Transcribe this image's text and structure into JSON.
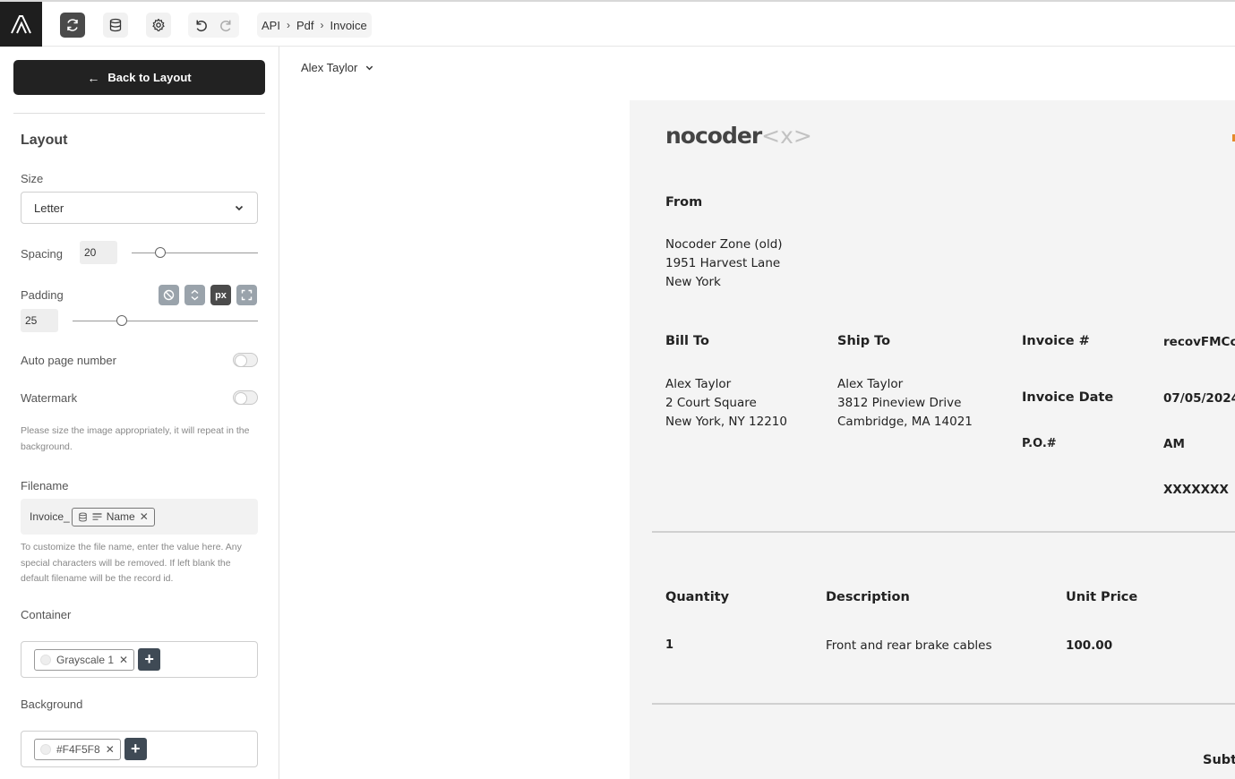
{
  "toolbar": {
    "logo_icon": "app-logo-icon",
    "breadcrumb": [
      "API",
      "Pdf",
      "Invoice"
    ]
  },
  "sidebar": {
    "back_label": "Back to Layout",
    "section_title": "Layout",
    "size_label": "Size",
    "size_value": "Letter",
    "spacing_label": "Spacing",
    "spacing_value": "20",
    "padding_label": "Padding",
    "padding_value": "25",
    "padding_unit": "px",
    "auto_page_number_label": "Auto page number",
    "auto_page_number_on": false,
    "watermark_label": "Watermark",
    "watermark_on": false,
    "watermark_help": "Please size the image appropriately, it will repeat in the background.",
    "filename_label": "Filename",
    "filename_prefix": "Invoice_",
    "filename_field": "Name",
    "filename_help": "To customize the file name, enter the value here. Any special characters will be removed. If left blank the default filename will be the record id.",
    "container_label": "Container",
    "container_value": "Grayscale 1",
    "background_label": "Background",
    "background_value": "#F4F5F8"
  },
  "main": {
    "record_selector": "Alex Taylor"
  },
  "invoice": {
    "brand": "nocoder",
    "brand_mark": "<x>",
    "from_heading": "From",
    "from_lines": [
      "Nocoder Zone (old)",
      "1951 Harvest Lane",
      "New York"
    ],
    "bill_to_heading": "Bill To",
    "bill_to_lines": [
      "Alex Taylor",
      "2 Court Square",
      "New York, NY 12210"
    ],
    "ship_to_heading": "Ship To",
    "ship_to_lines": [
      "Alex Taylor",
      "3812 Pineview Drive",
      "Cambridge, MA 14021"
    ],
    "invoice_no_label": "Invoice #",
    "invoice_no_value": "recovFMCc",
    "invoice_date_label": "Invoice Date",
    "invoice_date_value": "07/05/2024",
    "po_label": "P.O.#",
    "po_value": "AM",
    "extra_value": "XXXXXXX",
    "col_quantity": "Quantity",
    "col_description": "Description",
    "col_unit_price": "Unit Price",
    "row_quantity": "1",
    "row_description": "Front and rear brake cables",
    "row_unit_price": "100.00",
    "subtotal_label": "Subt"
  },
  "colors": {
    "dark": "#222222",
    "accent_orange": "#E48A2A",
    "canvas_bg": "#F4F4F4"
  }
}
